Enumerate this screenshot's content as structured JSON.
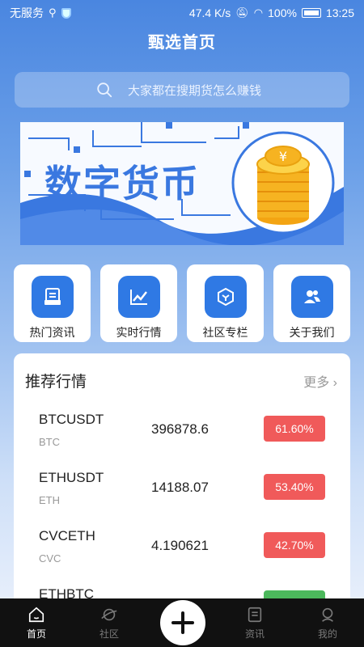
{
  "status_bar": {
    "carrier": "无服务",
    "speed": "47.4 K/s",
    "battery": "100%",
    "time": "13:25"
  },
  "header": {
    "title": "甄选首页"
  },
  "search": {
    "placeholder": "大家都在搜期货怎么赚钱"
  },
  "banner": {
    "text": "数字货币"
  },
  "menu": [
    {
      "label": "热门资讯",
      "icon": "news-icon"
    },
    {
      "label": "实时行情",
      "icon": "chart-icon"
    },
    {
      "label": "社区专栏",
      "icon": "cube-icon"
    },
    {
      "label": "关于我们",
      "icon": "users-icon"
    }
  ],
  "market": {
    "title": "推荐行情",
    "more": "更多",
    "rows": [
      {
        "pair": "BTCUSDT",
        "base": "BTC",
        "price": "396878.6",
        "change": "61.60%"
      },
      {
        "pair": "ETHUSDT",
        "base": "ETH",
        "price": "14188.07",
        "change": "53.40%"
      },
      {
        "pair": "CVCETH",
        "base": "CVC",
        "price": "4.190621",
        "change": "42.70%"
      },
      {
        "pair": "ETHBTC",
        "base": "",
        "price": "",
        "change": ""
      }
    ]
  },
  "tabs": [
    {
      "label": "首页",
      "icon": "home-icon"
    },
    {
      "label": "社区",
      "icon": "planet-icon"
    },
    {
      "label": "资讯",
      "icon": "document-icon"
    },
    {
      "label": "我的",
      "icon": "profile-icon"
    }
  ],
  "colors": {
    "primary": "#2f79e4",
    "up": "#f05a5a",
    "down": "#4cb85c"
  }
}
